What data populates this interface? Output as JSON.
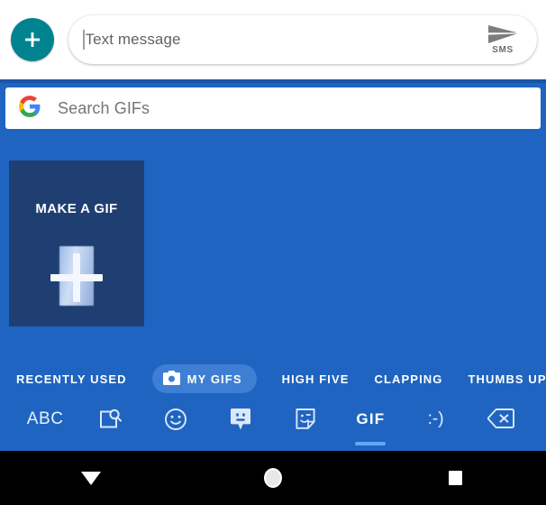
{
  "compose": {
    "add_button_icon": "plus-icon",
    "placeholder": "Text message",
    "value": "",
    "send_icon": "send-icon",
    "send_label": "SMS",
    "fab_color": "#00838f"
  },
  "gif_panel": {
    "background_color": "#1f64c0",
    "search": {
      "logo": "google-g-icon",
      "placeholder": "Search GIFs",
      "value": ""
    },
    "tiles": [
      {
        "label": "MAKE A GIF",
        "icon": "plus-icon",
        "background_color": "#1f3f73"
      }
    ],
    "categories": [
      {
        "label": "RECENTLY USED",
        "selected": false,
        "icon": null
      },
      {
        "label": "MY GIFS",
        "selected": true,
        "icon": "camera-icon"
      },
      {
        "label": "HIGH FIVE",
        "selected": false,
        "icon": null
      },
      {
        "label": "CLAPPING",
        "selected": false,
        "icon": null
      },
      {
        "label": "THUMBS UP",
        "selected": false,
        "icon": null
      }
    ],
    "selected_pill_color": "#3e7fd4"
  },
  "keyboard_toolbar": {
    "items": [
      {
        "label": "ABC",
        "icon": "abc-text",
        "selected": false
      },
      {
        "label": "",
        "icon": "image-search-icon",
        "selected": false
      },
      {
        "label": "",
        "icon": "emoji-smiley-icon",
        "selected": false
      },
      {
        "label": "",
        "icon": "bitmoji-avatar-icon",
        "selected": false
      },
      {
        "label": "",
        "icon": "sticker-icon",
        "selected": false
      },
      {
        "label": "GIF",
        "icon": "gif-text",
        "selected": true
      },
      {
        "label": ":-)",
        "icon": "emoticon-text",
        "selected": false
      },
      {
        "label": "",
        "icon": "backspace-icon",
        "selected": false
      }
    ],
    "selected_indicator_color": "#5fa8f5"
  },
  "navbar": {
    "background_color": "#000000",
    "buttons": [
      {
        "icon": "back-triangle-icon",
        "name": "back"
      },
      {
        "icon": "home-circle-icon",
        "name": "home"
      },
      {
        "icon": "recents-square-icon",
        "name": "recents"
      }
    ]
  }
}
